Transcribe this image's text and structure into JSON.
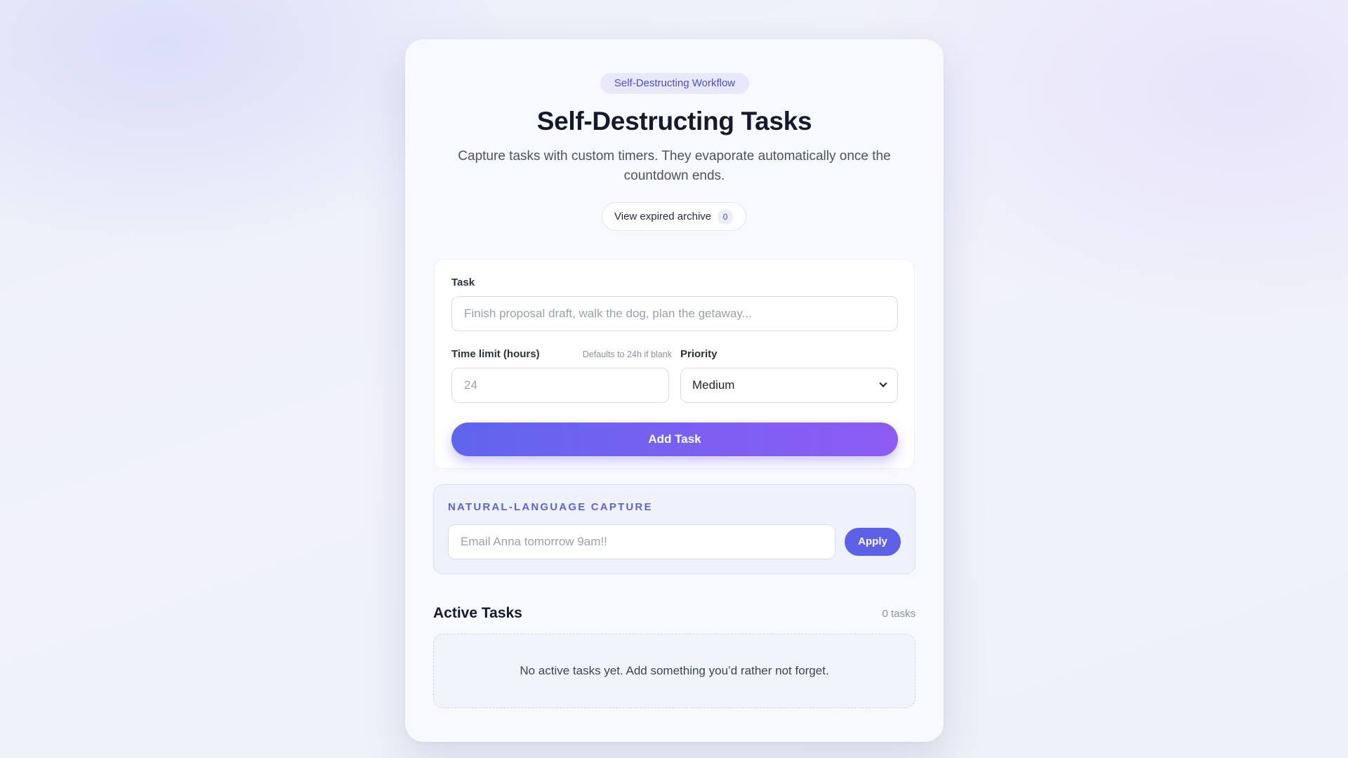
{
  "header": {
    "badge": "Self-Destructing Workflow",
    "title": "Self-Destructing Tasks",
    "subtitle": "Capture tasks with custom timers. They evaporate automatically once the countdown ends."
  },
  "archive": {
    "label": "View expired archive",
    "count": "0"
  },
  "form": {
    "task_label": "Task",
    "task_placeholder": "Finish proposal draft, walk the dog, plan the getaway...",
    "task_value": "",
    "time_label": "Time limit (hours)",
    "time_hint": "Defaults to 24h if blank",
    "time_placeholder": "24",
    "time_value": "",
    "priority_label": "Priority",
    "priority_selected": "Medium",
    "add_button": "Add Task"
  },
  "nl_capture": {
    "title": "NATURAL-LANGUAGE CAPTURE",
    "placeholder": "Email Anna tomorrow 9am!!",
    "value": "",
    "apply_button": "Apply"
  },
  "tasks": {
    "section_title": "Active Tasks",
    "count_label": "0 tasks",
    "empty_message": "No active tasks yet. Add something you’d rather not forget."
  },
  "colors": {
    "accent": "#5d61e6",
    "gradient_end": "#8d5cf2",
    "title": "#141a2c"
  }
}
